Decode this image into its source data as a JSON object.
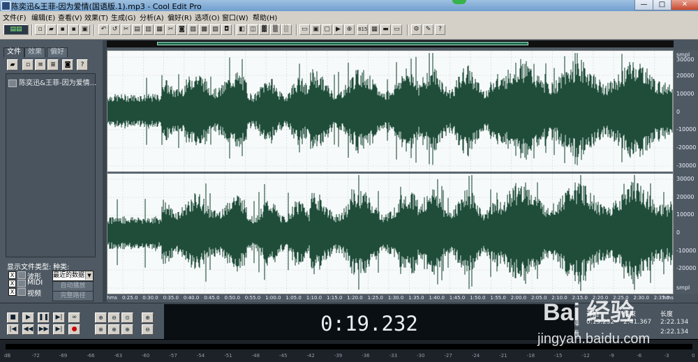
{
  "window": {
    "title": "陈奕迅&王菲-因为爱情(国语版.1).mp3 - Cool Edit Pro",
    "min": "—",
    "max": "□",
    "close": "✕"
  },
  "menu": [
    "文件(F)",
    "编辑(E)",
    "查看(V)",
    "效果(T)",
    "生成(G)",
    "分析(A)",
    "偏好(R)",
    "选项(O)",
    "窗口(W)",
    "帮助(H)"
  ],
  "left_panel": {
    "tabs": [
      "文件",
      "效果",
      "偏好"
    ],
    "files": [
      "陈奕迅&王菲-因为爱情..."
    ],
    "show_types_label": "显示文件类型:",
    "sort_label": "种类:",
    "sort_value": "最近的数据",
    "types": [
      {
        "label": "波形",
        "checked": "X"
      },
      {
        "label": "MIDI",
        "checked": "X"
      },
      {
        "label": "视频",
        "checked": "X"
      }
    ],
    "auto_play": "自动播放",
    "full_path": "完整路径"
  },
  "waveform": {
    "color": "#1f4d3a",
    "unit_top": "smpl",
    "unit_bottom": "hms",
    "amp_ticks": [
      "30000",
      "20000",
      "10000",
      "0",
      "-10000",
      "-20000",
      "-30000"
    ],
    "time_ticks": [
      "0:25.0",
      "0:30.0",
      "0:35.0",
      "0:40.0",
      "0:45.0",
      "0:50.0",
      "0:55.0",
      "1:00.0",
      "1:05.0",
      "1:10.0",
      "1:15.0",
      "1:20.0",
      "1:25.0",
      "1:30.0",
      "1:35.0",
      "1:40.0",
      "1:45.0",
      "1:50.0",
      "1:55.0",
      "2:00.0",
      "2:05.0",
      "2:10.0",
      "2:15.0",
      "2:20.0",
      "2:25.0",
      "2:30.0",
      "2:35.0"
    ]
  },
  "transport": {
    "time": "0:19.232",
    "labels": {
      "begin": "开始",
      "end": "结束",
      "length": "长度",
      "selection": "选择",
      "view": "查看"
    },
    "values": {
      "sel_begin": "0:19.232",
      "sel_end": "2:41.367",
      "sel_length": "2:22.134",
      "view_length": "2:22.134"
    }
  },
  "meter_ticks": [
    "dB",
    "-72",
    "-69",
    "-66",
    "-63",
    "-60",
    "-57",
    "-54",
    "-51",
    "-48",
    "-45",
    "-42",
    "-39",
    "-36",
    "-33",
    "-30",
    "-27",
    "-24",
    "-21",
    "-18",
    "-15",
    "-12",
    "-9",
    "-6",
    "-3",
    "0"
  ],
  "watermark": {
    "brand": "Bai 经验",
    "url": "jingyan.baidu.com"
  }
}
